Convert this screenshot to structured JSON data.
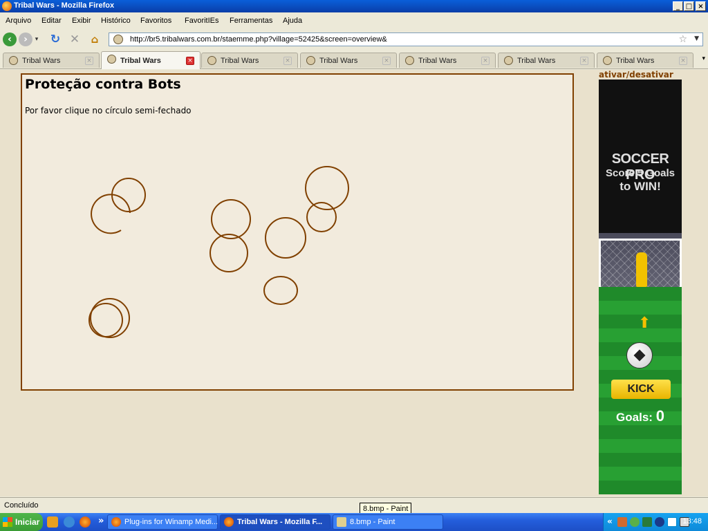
{
  "window": {
    "title": "Tribal Wars - Mozilla Firefox",
    "min": "_",
    "max": "□",
    "close": "×"
  },
  "menu": [
    "Arquivo",
    "Editar",
    "Exibir",
    "Histórico",
    "Favoritos",
    "FavoritIEs",
    "Ferramentas",
    "Ajuda"
  ],
  "nav": {
    "url": "http://br5.tribalwars.com.br/staemme.php?village=52425&screen=overview&"
  },
  "tabs": [
    "Tribal Wars",
    "Tribal Wars",
    "Tribal Wars",
    "Tribal Wars",
    "Tribal Wars",
    "Tribal Wars",
    "Tribal Wars"
  ],
  "page": {
    "heading": "Proteção contra Bots",
    "instruction": "Por favor clique no círculo semi-fechado",
    "circle_color": "#804000",
    "ad_toggle": "ativar/desativar"
  },
  "ad": {
    "line1": "SOCCER PRO",
    "line2": "Score 5 Goals",
    "line3": "to WIN!",
    "kick": "KICK",
    "goals_label": "Goals:",
    "goals_value": "0"
  },
  "status": {
    "text": "Concluído",
    "tooltip": "8.bmp - Paint"
  },
  "taskbar": {
    "start": "Iniciar",
    "overflow": "»",
    "buttons": [
      "Plug-ins for Winamp Medi...",
      "Tribal Wars - Mozilla F...",
      "8.bmp - Paint"
    ],
    "tray_overflow": "«",
    "clock": "13:48"
  }
}
